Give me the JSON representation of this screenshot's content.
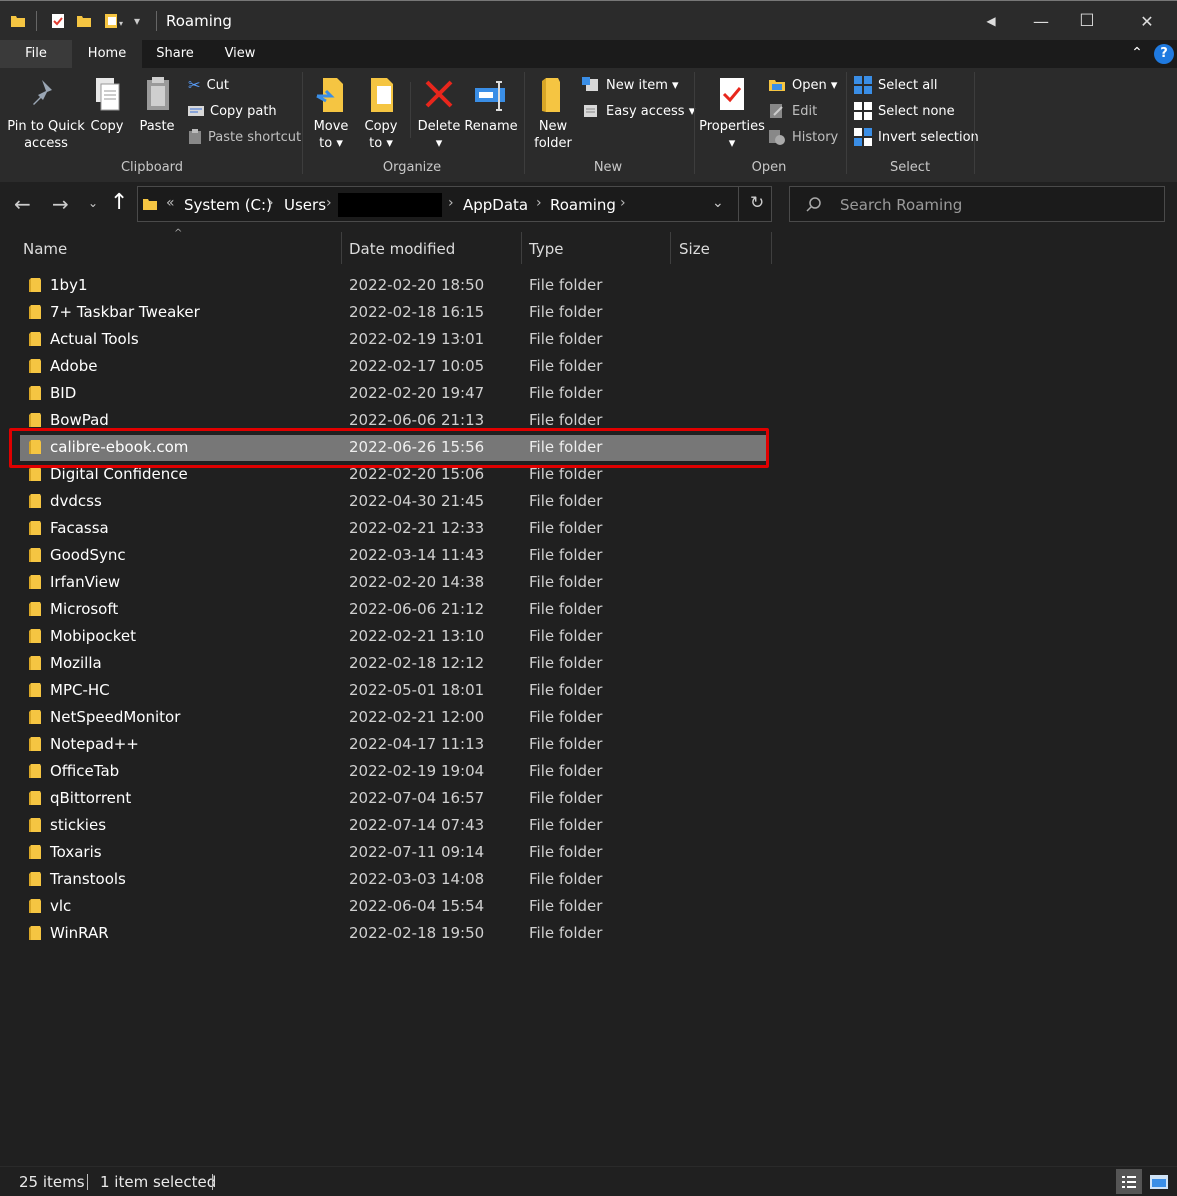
{
  "window": {
    "title": "Roaming",
    "controls": {
      "minimize": "—",
      "maximize": "☐",
      "close": "✕"
    }
  },
  "ribbon_tabs": [
    "File",
    "Home",
    "Share",
    "View"
  ],
  "ribbon": {
    "clipboard": {
      "label": "Clipboard",
      "pin_label_1": "Pin to Quick",
      "pin_label_2": "access",
      "copy": "Copy",
      "paste": "Paste",
      "cut": "Cut",
      "copy_path": "Copy path",
      "paste_shortcut": "Paste shortcut"
    },
    "organize": {
      "label": "Organize",
      "move_1": "Move",
      "move_2": "to ▾",
      "copy_1": "Copy",
      "copy_2": "to ▾",
      "delete_1": "Delete",
      "delete_2": "▾",
      "rename": "Rename"
    },
    "new": {
      "label": "New",
      "new_folder_1": "New",
      "new_folder_2": "folder",
      "new_item": "New item ▾",
      "easy_access": "Easy access ▾"
    },
    "open": {
      "label": "Open",
      "properties": "Properties",
      "properties_arrow": "▾",
      "open": "Open ▾",
      "edit": "Edit",
      "history": "History"
    },
    "select": {
      "label": "Select",
      "select_all": "Select all",
      "select_none": "Select none",
      "invert": "Invert selection"
    }
  },
  "address": {
    "overflow": "«",
    "crumbs": [
      "System (C:)",
      "Users",
      "",
      "AppData",
      "Roaming"
    ],
    "search_placeholder": "Search Roaming"
  },
  "columns": [
    "Name",
    "Date modified",
    "Type",
    "Size"
  ],
  "files": [
    {
      "name": "1by1",
      "date": "2022-02-20 18:50",
      "type": "File folder"
    },
    {
      "name": "7+ Taskbar Tweaker",
      "date": "2022-02-18 16:15",
      "type": "File folder"
    },
    {
      "name": "Actual Tools",
      "date": "2022-02-19 13:01",
      "type": "File folder"
    },
    {
      "name": "Adobe",
      "date": "2022-02-17 10:05",
      "type": "File folder"
    },
    {
      "name": "BID",
      "date": "2022-02-20 19:47",
      "type": "File folder"
    },
    {
      "name": "BowPad",
      "date": "2022-06-06 21:13",
      "type": "File folder"
    },
    {
      "name": "calibre-ebook.com",
      "date": "2022-06-26 15:56",
      "type": "File folder"
    },
    {
      "name": "Digital Confidence",
      "date": "2022-02-20 15:06",
      "type": "File folder"
    },
    {
      "name": "dvdcss",
      "date": "2022-04-30 21:45",
      "type": "File folder"
    },
    {
      "name": "Facassa",
      "date": "2022-02-21 12:33",
      "type": "File folder"
    },
    {
      "name": "GoodSync",
      "date": "2022-03-14 11:43",
      "type": "File folder"
    },
    {
      "name": "IrfanView",
      "date": "2022-02-20 14:38",
      "type": "File folder"
    },
    {
      "name": "Microsoft",
      "date": "2022-06-06 21:12",
      "type": "File folder"
    },
    {
      "name": "Mobipocket",
      "date": "2022-02-21 13:10",
      "type": "File folder"
    },
    {
      "name": "Mozilla",
      "date": "2022-02-18 12:12",
      "type": "File folder"
    },
    {
      "name": "MPC-HC",
      "date": "2022-05-01 18:01",
      "type": "File folder"
    },
    {
      "name": "NetSpeedMonitor",
      "date": "2022-02-21 12:00",
      "type": "File folder"
    },
    {
      "name": "Notepad++",
      "date": "2022-04-17 11:13",
      "type": "File folder"
    },
    {
      "name": "OfficeTab",
      "date": "2022-02-19 19:04",
      "type": "File folder"
    },
    {
      "name": "qBittorrent",
      "date": "2022-07-04 16:57",
      "type": "File folder"
    },
    {
      "name": "stickies",
      "date": "2022-07-14 07:43",
      "type": "File folder"
    },
    {
      "name": "Toxaris",
      "date": "2022-07-11 09:14",
      "type": "File folder"
    },
    {
      "name": "Transtools",
      "date": "2022-03-03 14:08",
      "type": "File folder"
    },
    {
      "name": "vlc",
      "date": "2022-06-04 15:54",
      "type": "File folder"
    },
    {
      "name": "WinRAR",
      "date": "2022-02-18 19:50",
      "type": "File folder"
    }
  ],
  "selected_index": 6,
  "status": {
    "count": "25 items",
    "selected": "1 item selected"
  },
  "colors": {
    "background": "#202020",
    "ribbon": "#2b2b2b",
    "selection": "#777777",
    "highlight_box": "#e00000",
    "folder": "#f5c542"
  }
}
